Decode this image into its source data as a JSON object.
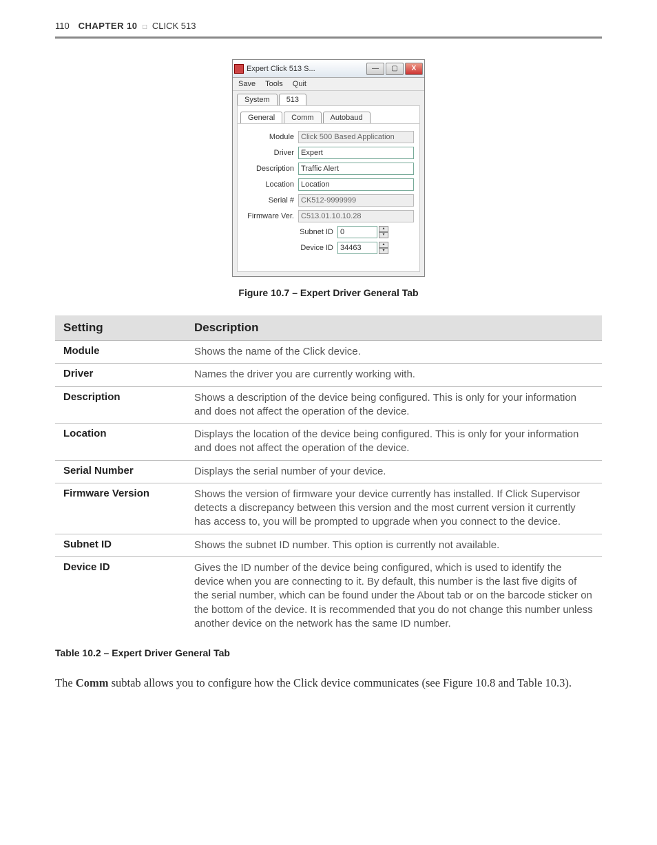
{
  "header": {
    "page_number": "110",
    "chapter": "CHAPTER 10",
    "section": "CLICK 513"
  },
  "screenshot": {
    "title": "Expert Click 513 S...",
    "menu": {
      "save": "Save",
      "tools": "Tools",
      "quit": "Quit"
    },
    "outer_tabs": {
      "system": "System",
      "num": "513"
    },
    "inner_tabs": {
      "general": "General",
      "comm": "Comm",
      "autobaud": "Autobaud"
    },
    "fields": {
      "module_label": "Module",
      "module_value": "Click 500 Based Application",
      "driver_label": "Driver",
      "driver_value": "Expert",
      "description_label": "Description",
      "description_value": "Traffic Alert",
      "location_label": "Location",
      "location_value": "Location",
      "serial_label": "Serial #",
      "serial_value": "CK512-9999999",
      "firmware_label": "Firmware Ver.",
      "firmware_value": "C513.01.10.10.28",
      "subnet_label": "Subnet ID",
      "subnet_value": "0",
      "device_label": "Device ID",
      "device_value": "34463"
    }
  },
  "figure_caption": "Figure 10.7 – Expert Driver General Tab",
  "table": {
    "h1": "Setting",
    "h2": "Description",
    "rows": [
      {
        "k": "Module",
        "v": "Shows the name of the Click device."
      },
      {
        "k": "Driver",
        "v": "Names the driver you are currently working with."
      },
      {
        "k": "Description",
        "v": "Shows a description of the device being configured. This is only for your information and does not affect the operation of the device."
      },
      {
        "k": "Location",
        "v": "Displays the location of the device being configured. This is only for your information and does not affect the operation of the device."
      },
      {
        "k": "Serial Number",
        "v": "Displays the serial number of your device."
      },
      {
        "k": "Firmware Version",
        "v": "Shows the version of firmware your device currently has installed. If Click Supervisor detects a discrepancy between this version and the most current version it currently has access to, you will be prompted to upgrade when you connect to the device."
      },
      {
        "k": "Subnet ID",
        "v": "Shows the subnet ID number. This option is currently not available."
      },
      {
        "k": "Device ID",
        "v": "Gives the ID number of the device being configured, which is used to identify the device when you are connecting to it. By default, this number is the last five digits of the serial number, which can be found under the About tab or on the barcode sticker on the bottom of the device. It is recommended that you do not change this number unless another device on the network has the same ID number."
      }
    ]
  },
  "table_caption": "Table 10.2 – Expert Driver General Tab",
  "body": {
    "line1a": "The ",
    "line1b": "Comm",
    "line1c": " subtab allows you to configure how the Click device communicates (see Figure 10.8 and Table 10.3)."
  }
}
